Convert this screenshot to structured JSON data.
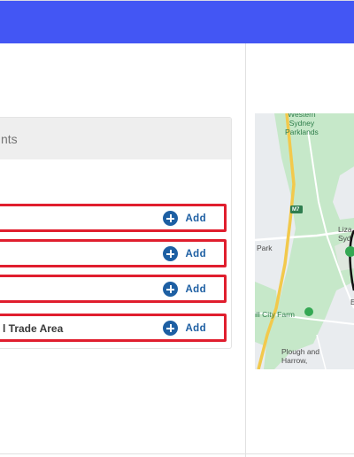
{
  "card": {
    "title": "nts"
  },
  "rows": [
    {
      "label": "",
      "add_label": "Add"
    },
    {
      "label": "",
      "add_label": "Add"
    },
    {
      "label": "",
      "add_label": "Add"
    },
    {
      "label": "l Trade Area",
      "add_label": "Add"
    }
  ],
  "map": {
    "labels": {
      "western_sydney_parklands": "Western\nSydney\nParklands",
      "m7": "M7",
      "park": "Park",
      "liza": "Liza",
      "syd": "Syd",
      "hill_city_farm": "Hill City Farm",
      "plough_and_harrow": "Plough and\nHarrow,",
      "b": "E"
    },
    "colors": {
      "park_green": "#c6e8c9",
      "land": "#e9ecef",
      "motorway": "#f2c94c",
      "pin": "#34a853"
    }
  },
  "colors": {
    "topbar": "#4356f4",
    "highlight_border": "#e01e2e",
    "add_blue": "#1d5fa3"
  }
}
